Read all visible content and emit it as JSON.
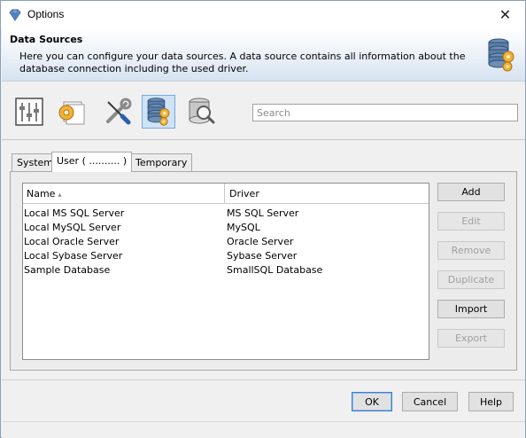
{
  "window": {
    "title": "Options",
    "close_glyph": "✕"
  },
  "header": {
    "title": "Data Sources",
    "description": "Here you can configure your data sources. A data source contains all information about the database connection including the used driver.",
    "icon": "database-gears-icon"
  },
  "toolbar": {
    "items": [
      {
        "icon": "sliders-icon",
        "active": false
      },
      {
        "icon": "gear-pages-icon",
        "active": false
      },
      {
        "icon": "wrench-screwdriver-icon",
        "active": false
      },
      {
        "icon": "database-gears-icon",
        "active": true
      },
      {
        "icon": "database-search-icon",
        "active": false
      }
    ],
    "search_placeholder": "Search"
  },
  "tabs": [
    {
      "label": "System",
      "active": false
    },
    {
      "label": "User (  ..........  )",
      "active": true
    },
    {
      "label": "Temporary",
      "active": false
    }
  ],
  "table": {
    "columns": [
      "Name",
      "Driver"
    ],
    "sort_indicator": "▴",
    "rows": [
      {
        "name": "Local MS SQL Server",
        "driver": "MS SQL Server"
      },
      {
        "name": "Local MySQL Server",
        "driver": "MySQL"
      },
      {
        "name": "Local Oracle Server",
        "driver": "Oracle Server"
      },
      {
        "name": "Local Sybase Server",
        "driver": "Sybase Server"
      },
      {
        "name": "Sample Database",
        "driver": "SmallSQL Database"
      }
    ]
  },
  "side_buttons": [
    {
      "label": "Add",
      "enabled": true
    },
    {
      "label": "Edit",
      "enabled": false
    },
    {
      "label": "Remove",
      "enabled": false
    },
    {
      "label": "Duplicate",
      "enabled": false
    },
    {
      "label": "Import",
      "enabled": true
    },
    {
      "label": "Export",
      "enabled": false
    }
  ],
  "dialog_buttons": {
    "ok": "OK",
    "cancel": "Cancel",
    "help": "Help"
  },
  "colors": {
    "accent": "#3c7fd1",
    "active_tool_bg": "#cfe3f7"
  }
}
